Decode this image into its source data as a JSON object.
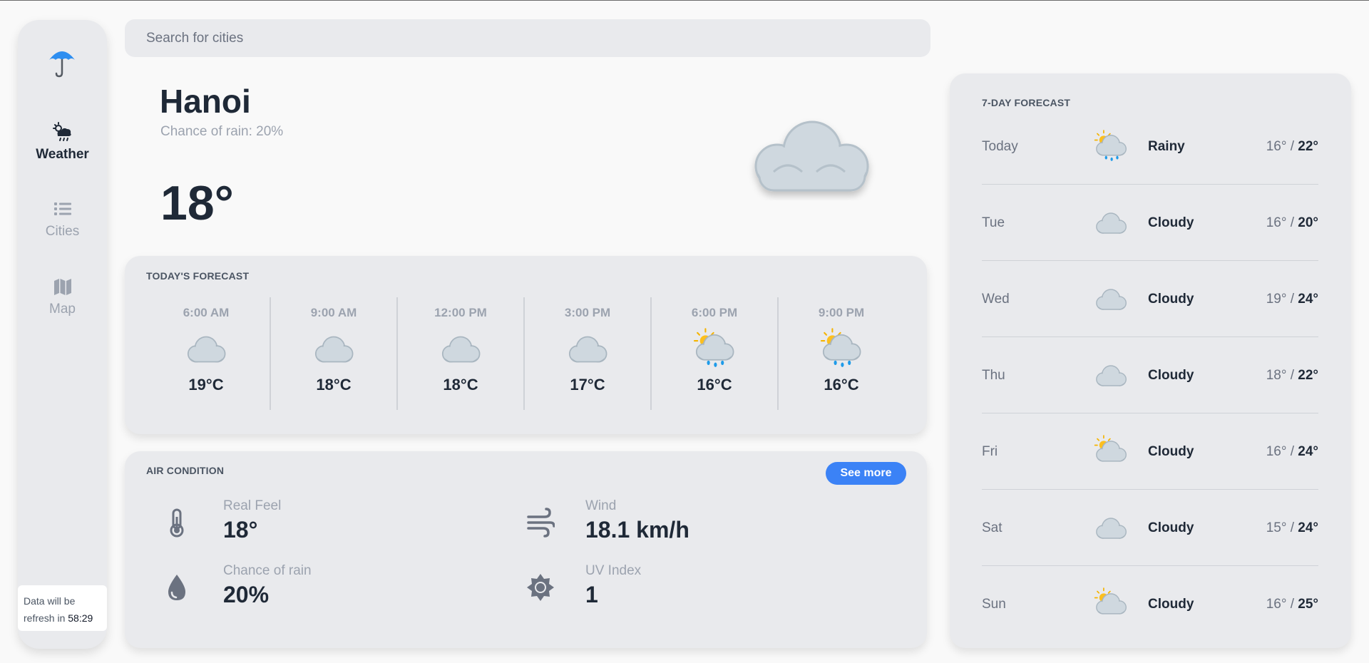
{
  "sidebar": {
    "logo_icon": "umbrella-icon",
    "items": [
      {
        "label": "Weather",
        "icon": "cloud-sun-rain-icon",
        "active": true
      },
      {
        "label": "Cities",
        "icon": "list-icon",
        "active": false
      },
      {
        "label": "Map",
        "icon": "map-icon",
        "active": false
      }
    ],
    "refresh_text_1": "Data will be",
    "refresh_text_2": "refresh in",
    "refresh_timer": "58:29"
  },
  "search": {
    "placeholder": "Search for cities"
  },
  "current": {
    "city": "Hanoi",
    "chance_of_rain": "Chance of rain: 20%",
    "temperature": "18°",
    "icon": "cloud-icon"
  },
  "today_forecast": {
    "title": "Today's forecast",
    "hours": [
      {
        "time": "6:00 AM",
        "icon": "cloud-icon",
        "temp": "19°C"
      },
      {
        "time": "9:00 AM",
        "icon": "cloud-icon",
        "temp": "18°C"
      },
      {
        "time": "12:00 PM",
        "icon": "cloud-icon",
        "temp": "18°C"
      },
      {
        "time": "3:00 PM",
        "icon": "cloud-icon",
        "temp": "17°C"
      },
      {
        "time": "6:00 PM",
        "icon": "sun-rain-icon",
        "temp": "16°C"
      },
      {
        "time": "9:00 PM",
        "icon": "sun-rain-icon",
        "temp": "16°C"
      }
    ]
  },
  "air_condition": {
    "title": "Air condition",
    "see_more": "See more",
    "real_feel": {
      "label": "Real Feel",
      "value": "18°",
      "icon": "thermometer-icon"
    },
    "wind": {
      "label": "Wind",
      "value": "18.1 km/h",
      "icon": "wind-icon"
    },
    "rain": {
      "label": "Chance of rain",
      "value": "20%",
      "icon": "water-drop-icon"
    },
    "uv": {
      "label": "UV Index",
      "value": "1",
      "icon": "sun-icon"
    }
  },
  "week_forecast": {
    "title": "7-day forecast",
    "days": [
      {
        "day": "Today",
        "icon": "sun-rain-icon",
        "condition": "Rainy",
        "low": "16°",
        "high": "22°"
      },
      {
        "day": "Tue",
        "icon": "cloud-icon",
        "condition": "Cloudy",
        "low": "16°",
        "high": "20°"
      },
      {
        "day": "Wed",
        "icon": "cloud-icon",
        "condition": "Cloudy",
        "low": "19°",
        "high": "24°"
      },
      {
        "day": "Thu",
        "icon": "cloud-icon",
        "condition": "Cloudy",
        "low": "18°",
        "high": "22°"
      },
      {
        "day": "Fri",
        "icon": "sun-cloud-icon",
        "condition": "Cloudy",
        "low": "16°",
        "high": "24°"
      },
      {
        "day": "Sat",
        "icon": "cloud-icon",
        "condition": "Cloudy",
        "low": "15°",
        "high": "24°"
      },
      {
        "day": "Sun",
        "icon": "sun-cloud-icon",
        "condition": "Cloudy",
        "low": "16°",
        "high": "25°"
      }
    ]
  },
  "colors": {
    "accent": "#3b82f6",
    "panel_bg": "#e9eaed",
    "page_bg": "#f9f9f9",
    "text_primary": "#1f2937",
    "text_muted": "#9ca3af"
  }
}
